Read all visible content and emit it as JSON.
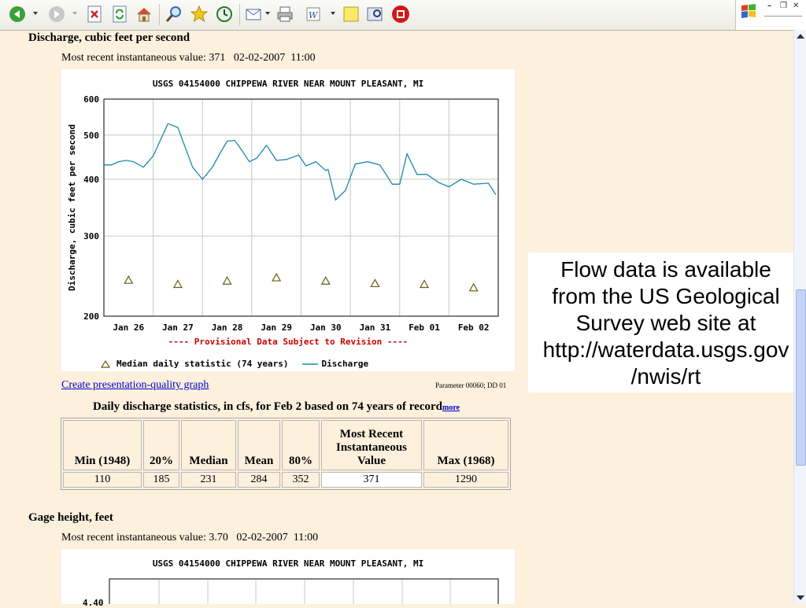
{
  "toolbar": {
    "icons": [
      "back-icon",
      "forward-icon",
      "stop-icon",
      "refresh-icon",
      "home-icon",
      "search-icon",
      "favorites-icon",
      "history-icon",
      "mail-icon",
      "print-icon",
      "edit-icon",
      "notes-icon",
      "research-icon",
      "messenger-icon"
    ]
  },
  "discharge": {
    "heading": "Discharge, cubic feet per second",
    "recent_value": "Most recent instantaneous value: 371   02-02-2007  11:00",
    "graph_title": "USGS 04154000 CHIPPEWA RIVER NEAR MOUNT PLEASANT, MI",
    "provisional": "---- Provisional Data Subject to Revision ----",
    "link_label": "Create presentation-quality graph",
    "param_note": "Parameter 00060; DD 01"
  },
  "stats": {
    "title": "Daily discharge statistics, in cfs, for Feb 2 based on 74 years of record",
    "more": "more",
    "headers": [
      "Min (1948)",
      "20%",
      "Median",
      "Mean",
      "80%",
      "Most Recent Instantaneous Value",
      "Max (1968)"
    ],
    "values": [
      "110",
      "185",
      "231",
      "284",
      "352",
      "371",
      "1290"
    ]
  },
  "gage": {
    "heading": "Gage height, feet",
    "recent_value": "Most recent instantaneous value: 3.70   02-02-2007  11:00",
    "graph_title": "USGS 04154000 CHIPPEWA RIVER NEAR MOUNT PLEASANT, MI",
    "partial_tick": "4.40"
  },
  "overlay_text": [
    "Flow data is available",
    "from the US Geological",
    "Survey web site at",
    "http://waterdata.usgs.gov",
    "/nwis/rt"
  ],
  "chart_data": {
    "type": "line",
    "title": "USGS 04154000 CHIPPEWA RIVER NEAR MOUNT PLEASANT, MI",
    "ylabel": "Discharge, cubic feet per second",
    "xlabel": "",
    "y_scale": "log",
    "ylim": [
      200,
      600
    ],
    "yticks": [
      200,
      300,
      400,
      500,
      600
    ],
    "x_ticks": [
      "Jan 26",
      "Jan 27",
      "Jan 28",
      "Jan 29",
      "Jan 30",
      "Jan 31",
      "Feb 01",
      "Feb 02"
    ],
    "xlim": [
      -0.5,
      7.5
    ],
    "grid": true,
    "legend": [
      "Median daily statistic (74 years)",
      "Discharge"
    ],
    "series": [
      {
        "name": "Median daily statistic (74 years)",
        "marker": "triangle",
        "color": "#6b5a14",
        "x": [
          0,
          1,
          2,
          3,
          4,
          5,
          6,
          7
        ],
        "values": [
          240,
          235,
          239,
          243,
          239,
          236,
          235,
          231
        ]
      },
      {
        "name": "Discharge",
        "color": "#1a8aa8",
        "x": [
          -0.5,
          -0.35,
          -0.2,
          -0.05,
          0.1,
          0.3,
          0.5,
          0.8,
          1.0,
          1.15,
          1.3,
          1.5,
          1.7,
          1.85,
          2.0,
          2.15,
          2.3,
          2.45,
          2.6,
          2.8,
          3.0,
          3.2,
          3.45,
          3.6,
          3.8,
          4.0,
          4.05,
          4.2,
          4.4,
          4.6,
          4.85,
          5.1,
          5.35,
          5.5,
          5.65,
          5.85,
          6.05,
          6.3,
          6.5,
          6.75,
          7.0,
          7.3,
          7.45
        ],
        "values": [
          430,
          430,
          437,
          440,
          437,
          425,
          450,
          530,
          520,
          470,
          425,
          400,
          425,
          455,
          485,
          487,
          463,
          437,
          445,
          475,
          440,
          442,
          452,
          428,
          437,
          418,
          420,
          360,
          378,
          432,
          437,
          430,
          390,
          390,
          455,
          410,
          410,
          393,
          385,
          400,
          390,
          392,
          370
        ]
      }
    ]
  },
  "colors": {
    "page_bg": "#fdf0dd",
    "discharge_line": "#1a8aa8",
    "median_marker": "#6b5a14",
    "provisional_text": "#cc0000",
    "link": "#0000cc"
  }
}
